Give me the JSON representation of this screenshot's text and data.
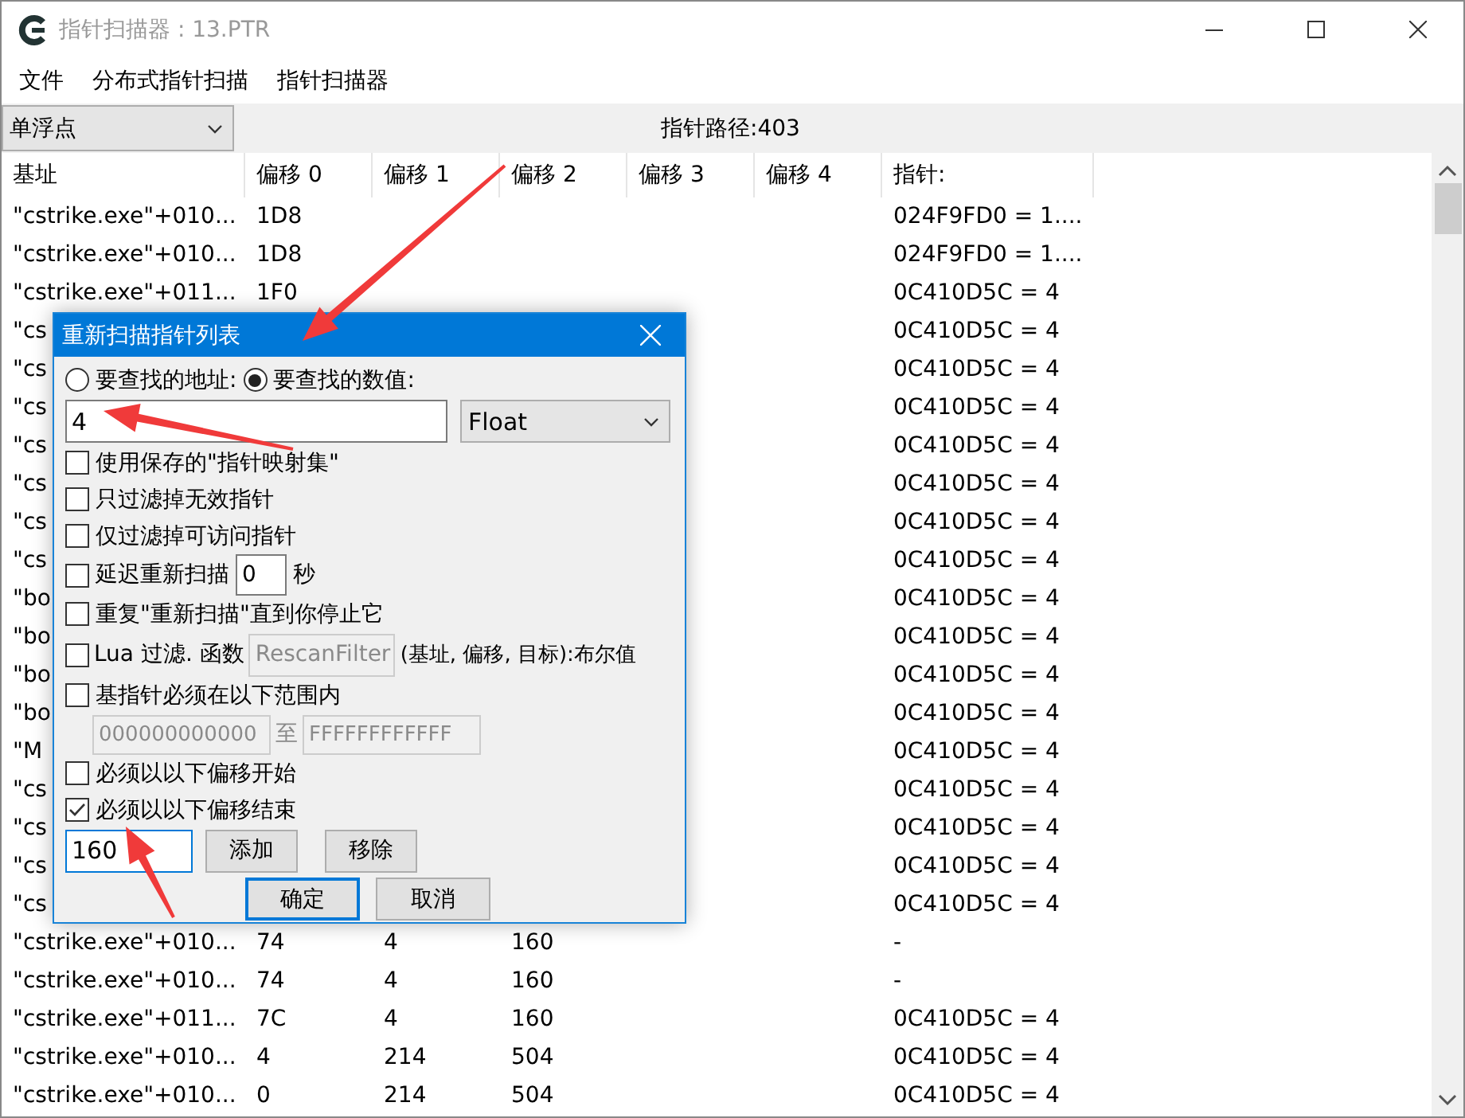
{
  "window": {
    "title": "指针扫描器 : 13.PTR"
  },
  "menu": [
    "文件",
    "分布式指针扫描",
    "指针扫描器"
  ],
  "toolbar": {
    "type_select": "单浮点",
    "path_count": "指针路径:403"
  },
  "table": {
    "columns": [
      "基址",
      "偏移 0",
      "偏移 1",
      "偏移 2",
      "偏移 3",
      "偏移 4",
      "指针:"
    ],
    "rows": [
      {
        "base": "\"cstrike.exe\"+010...",
        "offset_0": "1D8",
        "pointer": "024F9FD0 = 1...."
      },
      {
        "base": "\"cstrike.exe\"+010...",
        "offset_0": "1D8",
        "pointer": "024F9FD0 = 1...."
      },
      {
        "base": "\"cstrike.exe\"+011...",
        "offset_0": "1F0",
        "pointer": "0C410D5C = 4"
      },
      {
        "base": "\"cs",
        "pointer": "0C410D5C = 4"
      },
      {
        "base": "\"cs",
        "pointer": "0C410D5C = 4"
      },
      {
        "base": "\"cs",
        "pointer": "0C410D5C = 4"
      },
      {
        "base": "\"cs",
        "pointer": "0C410D5C = 4"
      },
      {
        "base": "\"cs",
        "pointer": "0C410D5C = 4"
      },
      {
        "base": "\"cs",
        "pointer": "0C410D5C = 4"
      },
      {
        "base": "\"cs",
        "pointer": "0C410D5C = 4"
      },
      {
        "base": "\"bo",
        "pointer": "0C410D5C = 4"
      },
      {
        "base": "\"bo",
        "pointer": "0C410D5C = 4"
      },
      {
        "base": "\"bo",
        "pointer": "0C410D5C = 4"
      },
      {
        "base": "\"bo",
        "pointer": "0C410D5C = 4"
      },
      {
        "base": "\"M",
        "pointer": "0C410D5C = 4"
      },
      {
        "base": "\"cs",
        "pointer": "0C410D5C = 4"
      },
      {
        "base": "\"cs",
        "pointer": "0C410D5C = 4"
      },
      {
        "base": "\"cs",
        "pointer": "0C410D5C = 4"
      },
      {
        "base": "\"cs",
        "pointer": "0C410D5C = 4"
      },
      {
        "base": "\"cstrike.exe\"+010...",
        "offset_0": "74",
        "offset_1": "4",
        "offset_2": "160",
        "pointer": "-"
      },
      {
        "base": "\"cstrike.exe\"+010...",
        "offset_0": "74",
        "offset_1": "4",
        "offset_2": "160",
        "pointer": "-"
      },
      {
        "base": "\"cstrike.exe\"+011...",
        "offset_0": "7C",
        "offset_1": "4",
        "offset_2": "160",
        "pointer": "0C410D5C = 4"
      },
      {
        "base": "\"cstrike.exe\"+010...",
        "offset_0": "4",
        "offset_1": "214",
        "offset_2": "504",
        "pointer": "0C410D5C = 4"
      },
      {
        "base": "\"cstrike.exe\"+010...",
        "offset_0": "0",
        "offset_1": "214",
        "offset_2": "504",
        "pointer": "0C410D5C = 4"
      }
    ]
  },
  "dialog": {
    "title": "重新扫描指针列表",
    "search_mode": [
      {
        "label": "要查找的地址:",
        "selected": false
      },
      {
        "label": "要查找的数值:",
        "selected": true
      }
    ],
    "value_field": {
      "value": "4"
    },
    "type_select": "Float",
    "options": [
      {
        "kind": "checkbox",
        "label": "使用保存的\"指针映射集\"",
        "checked": false
      },
      {
        "kind": "checkbox",
        "label": "只过滤掉无效指针",
        "checked": false
      },
      {
        "kind": "checkbox",
        "label": "仅过滤掉可访问指针",
        "checked": false
      },
      {
        "kind": "delay",
        "label": "延迟重新扫描",
        "checked": false,
        "value": "0",
        "unit": "秒"
      },
      {
        "kind": "checkbox",
        "label": "重复\"重新扫描\"直到你停止它",
        "checked": false
      },
      {
        "kind": "lua",
        "label": "Lua 过滤. 函数",
        "checked": false,
        "function": {
          "value": "RescanFilter",
          "disabled": true
        },
        "signature": "(基址, 偏移, 目标):布尔值"
      },
      {
        "kind": "range",
        "label": "基指针必须在以下范围内",
        "checked": false,
        "from": {
          "value": "000000000000",
          "disabled": true
        },
        "separator": "至",
        "to": {
          "value": "FFFFFFFFFFFF",
          "disabled": true
        }
      },
      {
        "kind": "checkbox",
        "label": "必须以以下偏移开始",
        "checked": false
      },
      {
        "kind": "checkbox",
        "label": "必须以以下偏移结束",
        "checked": true
      }
    ],
    "offset_field": {
      "value": "160"
    },
    "offset_buttons": [
      "添加",
      "移除"
    ],
    "buttons": [
      {
        "label": "确定",
        "default": true
      },
      {
        "label": "取消",
        "default": false
      }
    ]
  }
}
